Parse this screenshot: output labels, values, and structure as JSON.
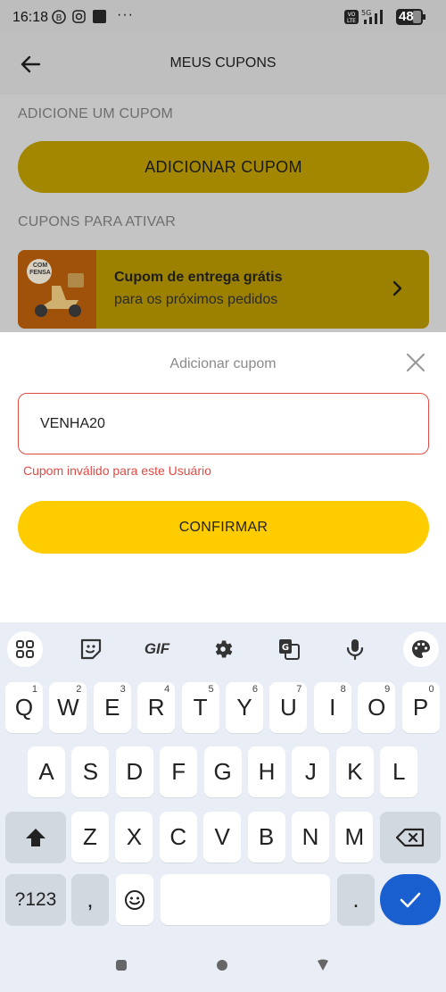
{
  "status_bar": {
    "time": "16:18",
    "battery": "48"
  },
  "header": {
    "title": "MEUS CUPONS"
  },
  "sections": {
    "add_label": "ADICIONE UM CUPOM",
    "activate_label": "CUPONS PARA ATIVAR"
  },
  "add_button": {
    "label": "ADICIONAR CUPOM"
  },
  "coupon_card": {
    "title": "Cupom de entrega grátis",
    "subtitle": "para os próximos pedidos",
    "thumb_text": "COM FENSA"
  },
  "sheet": {
    "title": "Adicionar cupom",
    "input_value": "VENHA20",
    "error": "Cupom inválido para este Usuário",
    "confirm_label": "CONFIRMAR"
  },
  "keyboard": {
    "gif_label": "GIF",
    "row1": [
      {
        "k": "Q",
        "h": "1"
      },
      {
        "k": "W",
        "h": "2"
      },
      {
        "k": "E",
        "h": "3"
      },
      {
        "k": "R",
        "h": "4"
      },
      {
        "k": "T",
        "h": "5"
      },
      {
        "k": "Y",
        "h": "6"
      },
      {
        "k": "U",
        "h": "7"
      },
      {
        "k": "I",
        "h": "8"
      },
      {
        "k": "O",
        "h": "9"
      },
      {
        "k": "P",
        "h": "0"
      }
    ],
    "row2": [
      "A",
      "S",
      "D",
      "F",
      "G",
      "H",
      "J",
      "K",
      "L"
    ],
    "row3": [
      "Z",
      "X",
      "C",
      "V",
      "B",
      "N",
      "M"
    ],
    "symbols_label": "?123",
    "comma": ",",
    "period": "."
  },
  "colors": {
    "accent": "#ffcc00",
    "error": "#e04b45",
    "enter": "#1a5fd0"
  }
}
